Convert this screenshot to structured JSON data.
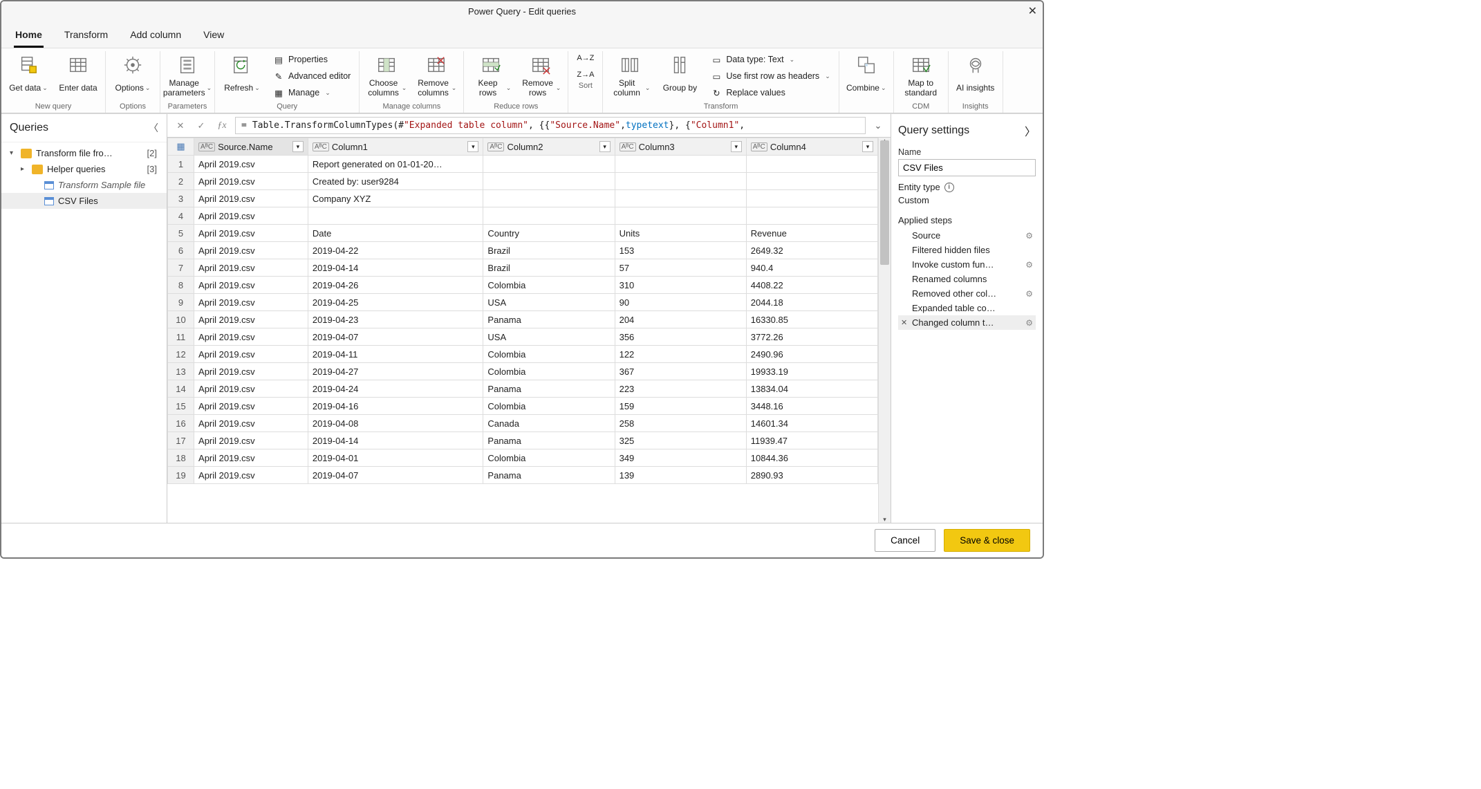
{
  "title": "Power Query - Edit queries",
  "tabs": [
    "Home",
    "Transform",
    "Add column",
    "View"
  ],
  "ribbon": {
    "groups": [
      {
        "label": "New query",
        "items": [
          {
            "t": "big",
            "label": "Get data",
            "icon": "db",
            "drop": true
          },
          {
            "t": "big",
            "label": "Enter data",
            "icon": "table"
          }
        ]
      },
      {
        "label": "Options",
        "items": [
          {
            "t": "big",
            "label": "Options",
            "icon": "gear",
            "drop": true
          }
        ]
      },
      {
        "label": "Parameters",
        "items": [
          {
            "t": "big",
            "label": "Manage parameters",
            "icon": "params",
            "drop": true
          }
        ]
      },
      {
        "label": "Query",
        "items": [
          {
            "t": "big",
            "label": "Refresh",
            "icon": "refresh",
            "drop": true
          },
          {
            "t": "smallcol",
            "items": [
              {
                "label": "Properties",
                "icon": "props"
              },
              {
                "label": "Advanced editor",
                "icon": "adv"
              },
              {
                "label": "Manage",
                "icon": "manage",
                "drop": true
              }
            ]
          }
        ]
      },
      {
        "label": "Manage columns",
        "items": [
          {
            "t": "big",
            "label": "Choose columns",
            "icon": "choosecol",
            "drop": true
          },
          {
            "t": "big",
            "label": "Remove columns",
            "icon": "removecol",
            "drop": true
          }
        ]
      },
      {
        "label": "Reduce rows",
        "items": [
          {
            "t": "big",
            "label": "Keep rows",
            "icon": "keeprows",
            "drop": true
          },
          {
            "t": "big",
            "label": "Remove rows",
            "icon": "removerows",
            "drop": true
          }
        ]
      },
      {
        "label": "Sort",
        "items": [
          {
            "t": "sortcol"
          }
        ]
      },
      {
        "label": "Transform",
        "items": [
          {
            "t": "big",
            "label": "Split column",
            "icon": "split",
            "drop": true
          },
          {
            "t": "big",
            "label": "Group by",
            "icon": "group"
          },
          {
            "t": "smallcol",
            "items": [
              {
                "label": "Data type: Text",
                "icon": "dtype",
                "drop": true
              },
              {
                "label": "Use first row as headers",
                "icon": "firstrow",
                "drop": true
              },
              {
                "label": "Replace values",
                "icon": "replace"
              }
            ]
          }
        ]
      },
      {
        "label": "",
        "items": [
          {
            "t": "big",
            "label": "Combine",
            "icon": "combine",
            "drop": true
          }
        ]
      },
      {
        "label": "CDM",
        "items": [
          {
            "t": "big",
            "label": "Map to standard",
            "icon": "cdm"
          }
        ]
      },
      {
        "label": "Insights",
        "items": [
          {
            "t": "big",
            "label": "AI insights",
            "icon": "ai"
          }
        ]
      }
    ]
  },
  "queries": {
    "title": "Queries",
    "items": [
      {
        "label": "Transform file fro…",
        "count": "[2]",
        "icon": "folder",
        "indent": 0,
        "expand": "▾"
      },
      {
        "label": "Helper queries",
        "count": "[3]",
        "icon": "folder",
        "indent": 1,
        "expand": "▸"
      },
      {
        "label": "Transform Sample file",
        "icon": "table",
        "indent": 2,
        "italic": true
      },
      {
        "label": "CSV Files",
        "icon": "table",
        "indent": 2,
        "selected": true
      }
    ]
  },
  "formula": {
    "prefix": "Table.TransformColumnTypes(#",
    "s1": "\"Expanded table column\"",
    "mid1": ", {{",
    "s2": "\"Source.Name\"",
    "mid2": ", ",
    "kw1": "type",
    "sp": " ",
    "kw2": "text",
    "mid3": "}, {",
    "s3": "\"Column1\"",
    "tail": ","
  },
  "columns": [
    "Source.Name",
    "Column1",
    "Column2",
    "Column3",
    "Column4"
  ],
  "rows": [
    [
      "April 2019.csv",
      "Report generated on 01-01-20…",
      "",
      "",
      ""
    ],
    [
      "April 2019.csv",
      "Created by: user9284",
      "",
      "",
      ""
    ],
    [
      "April 2019.csv",
      "Company XYZ",
      "",
      "",
      ""
    ],
    [
      "April 2019.csv",
      "",
      "",
      "",
      ""
    ],
    [
      "April 2019.csv",
      "Date",
      "Country",
      "Units",
      "Revenue"
    ],
    [
      "April 2019.csv",
      "2019-04-22",
      "Brazil",
      "153",
      "2649.32"
    ],
    [
      "April 2019.csv",
      "2019-04-14",
      "Brazil",
      "57",
      "940.4"
    ],
    [
      "April 2019.csv",
      "2019-04-26",
      "Colombia",
      "310",
      "4408.22"
    ],
    [
      "April 2019.csv",
      "2019-04-25",
      "USA",
      "90",
      "2044.18"
    ],
    [
      "April 2019.csv",
      "2019-04-23",
      "Panama",
      "204",
      "16330.85"
    ],
    [
      "April 2019.csv",
      "2019-04-07",
      "USA",
      "356",
      "3772.26"
    ],
    [
      "April 2019.csv",
      "2019-04-11",
      "Colombia",
      "122",
      "2490.96"
    ],
    [
      "April 2019.csv",
      "2019-04-27",
      "Colombia",
      "367",
      "19933.19"
    ],
    [
      "April 2019.csv",
      "2019-04-24",
      "Panama",
      "223",
      "13834.04"
    ],
    [
      "April 2019.csv",
      "2019-04-16",
      "Colombia",
      "159",
      "3448.16"
    ],
    [
      "April 2019.csv",
      "2019-04-08",
      "Canada",
      "258",
      "14601.34"
    ],
    [
      "April 2019.csv",
      "2019-04-14",
      "Panama",
      "325",
      "11939.47"
    ],
    [
      "April 2019.csv",
      "2019-04-01",
      "Colombia",
      "349",
      "10844.36"
    ],
    [
      "April 2019.csv",
      "2019-04-07",
      "Panama",
      "139",
      "2890.93"
    ]
  ],
  "settings": {
    "title": "Query settings",
    "name_label": "Name",
    "name_value": "CSV Files",
    "entity_label": "Entity type",
    "entity_value": "Custom",
    "steps_label": "Applied steps",
    "steps": [
      {
        "label": "Source",
        "gear": true
      },
      {
        "label": "Filtered hidden files"
      },
      {
        "label": "Invoke custom fun…",
        "gear": true
      },
      {
        "label": "Renamed columns"
      },
      {
        "label": "Removed other col…",
        "gear": true
      },
      {
        "label": "Expanded table co…"
      },
      {
        "label": "Changed column t…",
        "gear": true,
        "selected": true
      }
    ]
  },
  "footer": {
    "cancel": "Cancel",
    "save": "Save & close"
  }
}
